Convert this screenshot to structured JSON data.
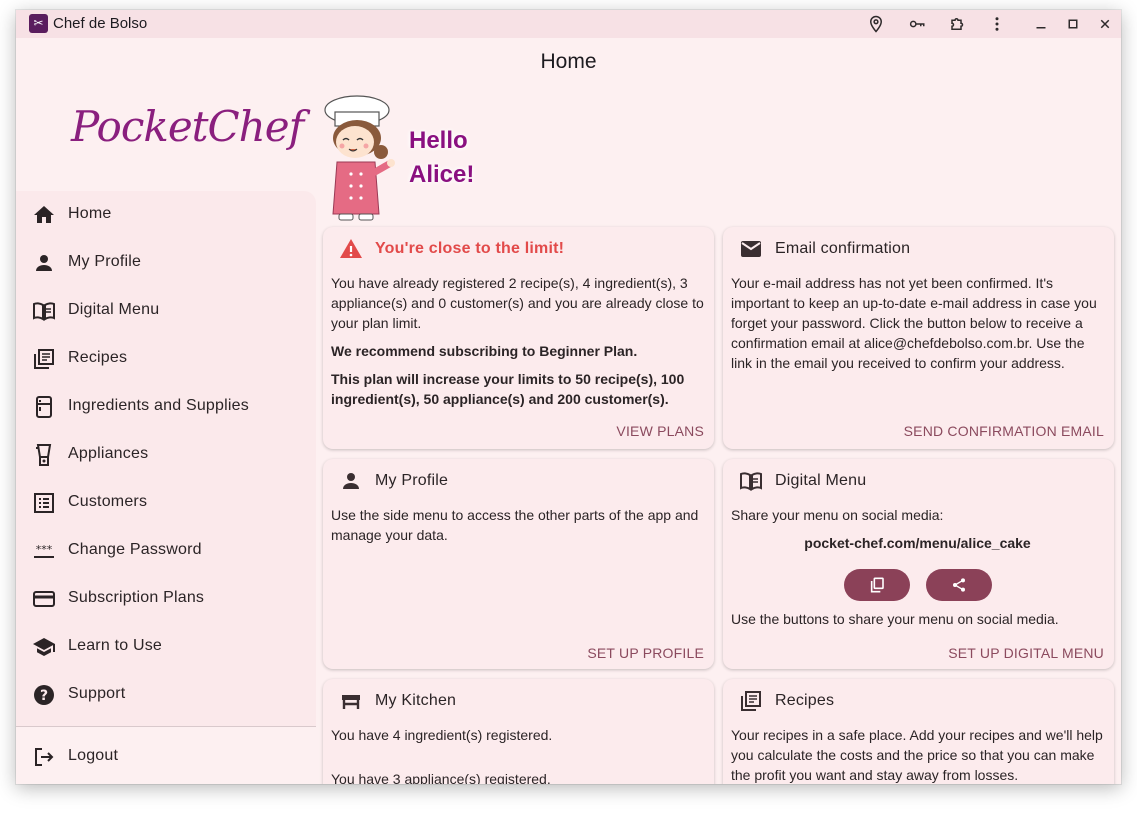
{
  "window": {
    "title": "Chef de Bolso"
  },
  "page": {
    "title": "Home"
  },
  "logo": {
    "text": "PocketChef"
  },
  "greeting": {
    "line1": "Hello",
    "line2": "Alice!"
  },
  "sidebar": {
    "items": [
      {
        "label": "Home",
        "icon": "home-icon"
      },
      {
        "label": "My Profile",
        "icon": "person-icon"
      },
      {
        "label": "Digital Menu",
        "icon": "menu-book-icon"
      },
      {
        "label": "Recipes",
        "icon": "library-books-icon"
      },
      {
        "label": "Ingredients and Supplies",
        "icon": "kitchen-icon"
      },
      {
        "label": "Appliances",
        "icon": "blender-icon"
      },
      {
        "label": "Customers",
        "icon": "list-alt-icon"
      },
      {
        "label": "Change Password",
        "icon": "password-icon"
      },
      {
        "label": "Subscription Plans",
        "icon": "credit-card-icon"
      },
      {
        "label": "Learn to Use",
        "icon": "school-icon"
      },
      {
        "label": "Support",
        "icon": "help-icon"
      }
    ],
    "logout": "Logout"
  },
  "cards": {
    "limit": {
      "title": "You're close to the limit!",
      "text1": "You have already registered 2 recipe(s), 4 ingredient(s), 3 appliance(s) and 0 customer(s) and you are already close to your plan limit.",
      "text2": "We recommend subscribing to Beginner Plan.",
      "text3": "This plan will increase your limits to 50 recipe(s), 100 ingredient(s), 50 appliance(s) and 200 customer(s).",
      "action": "VIEW PLANS"
    },
    "email": {
      "title": "Email confirmation",
      "text": "Your e-mail address has not yet been confirmed. It's important to keep an up-to-date e-mail address in case you forget your password. Click the button below to receive a confirmation email at alice@chefdebolso.com.br. Use the link in the email you received to confirm your address.",
      "action": "SEND CONFIRMATION EMAIL"
    },
    "profile": {
      "title": "My Profile",
      "text": "Use the side menu to access the other parts of the app and manage your data.",
      "action": "SET UP PROFILE"
    },
    "menu": {
      "title": "Digital Menu",
      "text1": "Share your menu on social media:",
      "url": "pocket-chef.com/menu/alice_cake",
      "text2": "Use the buttons to share your menu on social media.",
      "action": "SET UP DIGITAL MENU"
    },
    "kitchen": {
      "title": "My Kitchen",
      "text1": "You have 4 ingredient(s) registered.",
      "text2": "You have 3 appliance(s) registered."
    },
    "recipes": {
      "title": "Recipes",
      "text": "Your recipes in a safe place. Add your recipes and we'll help you calculate the costs and the price so that you can make the profit you want and stay away from losses."
    }
  }
}
